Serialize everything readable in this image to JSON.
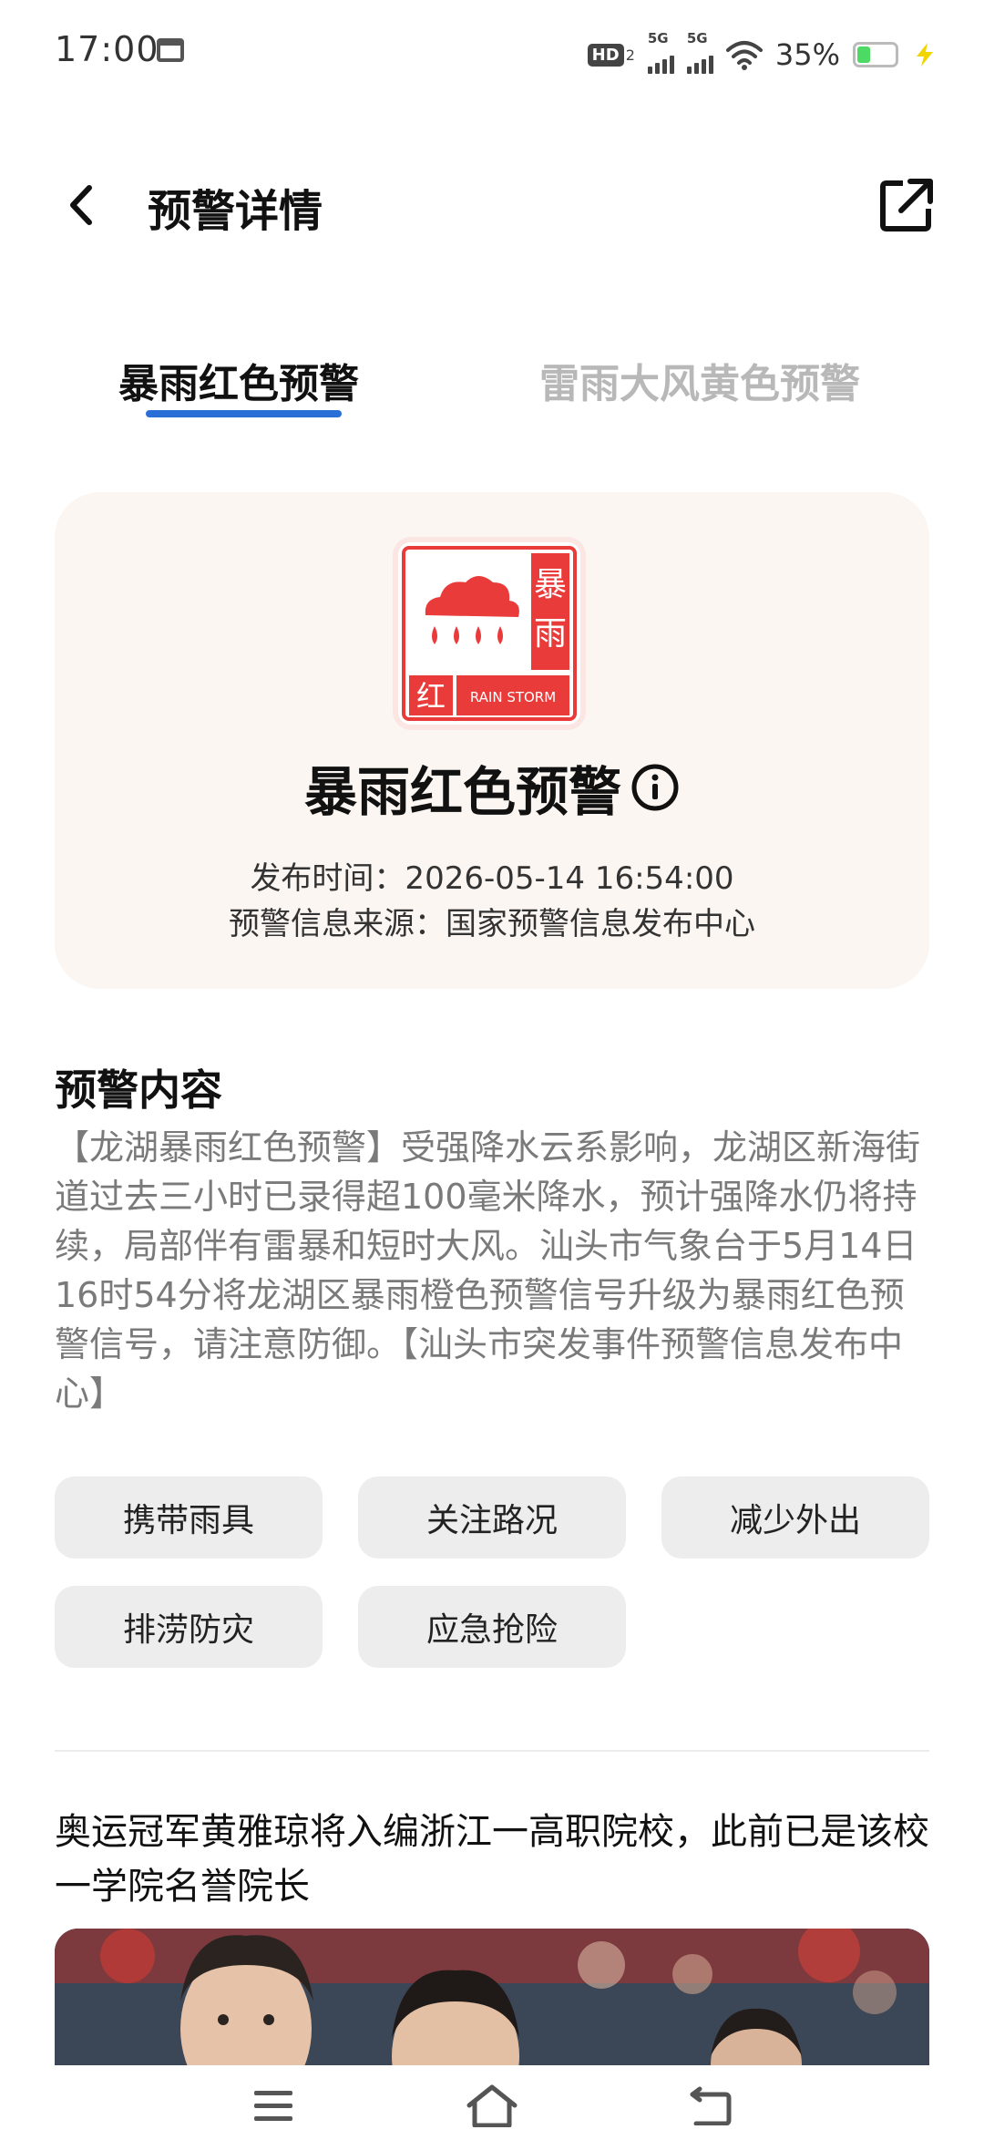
{
  "status_bar": {
    "time": "17:00",
    "hd_label": "HD",
    "hd_sub": "2",
    "sim1_label": "5G",
    "sim2_label": "5G",
    "battery_percent": "35%",
    "battery_level": 0.35
  },
  "header": {
    "title": "预警详情",
    "back_icon": "chevron-left-icon",
    "share_icon": "share-external-icon"
  },
  "tabs": [
    {
      "label": "暴雨红色预警",
      "active": true
    },
    {
      "label": "雷雨大风黄色预警",
      "active": false
    }
  ],
  "colors": {
    "accent": "#2a6fd8",
    "warning_red": "#ea3b3b",
    "card_bg": "#fcf6f2",
    "chip_bg": "#ededed"
  },
  "warning_card": {
    "icon": {
      "vertical_text_1": "暴",
      "vertical_text_2": "雨",
      "level_char": "红",
      "english_label": "RAIN STORM"
    },
    "title": "暴雨红色预警",
    "publish_time": "发布时间：2026-05-14 16:54:00",
    "source": "预警信息来源：国家预警信息发布中心"
  },
  "content": {
    "section_title": "预警内容",
    "text": "【龙湖暴雨红色预警】受强降水云系影响，龙湖区新海街道过去三小时已录得超100毫米降水，预计强降水仍将持续，局部伴有雷暴和短时大风。汕头市气象台于5月14日16时54分将龙湖区暴雨橙色预警信号升级为暴雨红色预警信号，请注意防御。【汕头市突发事件预警信息发布中心】"
  },
  "actions": [
    {
      "label": "携带雨具"
    },
    {
      "label": "关注路况"
    },
    {
      "label": "减少外出"
    },
    {
      "label": "排涝防灾"
    },
    {
      "label": "应急抢险"
    }
  ],
  "news": {
    "title": "奥运冠军黄雅琼将入编浙江一高职院校，此前已是该校一学院名誉院长"
  },
  "nav": {
    "menu_icon": "menu-icon",
    "home_icon": "home-icon",
    "back_icon": "back-icon"
  }
}
